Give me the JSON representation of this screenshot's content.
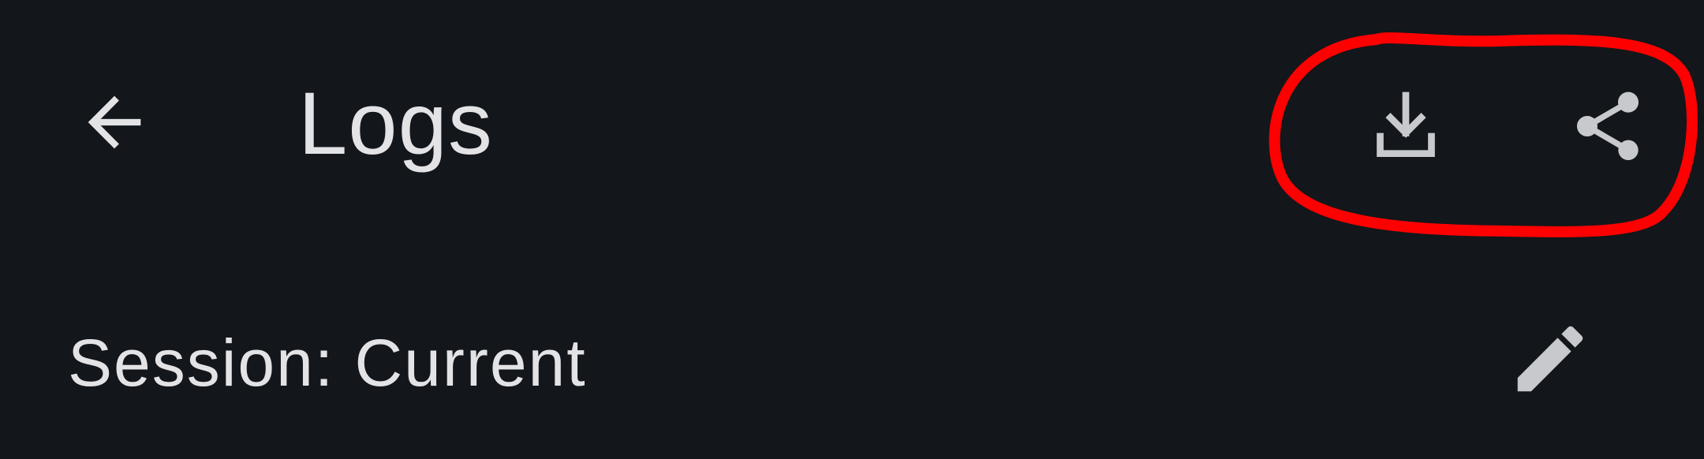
{
  "header": {
    "title": "Logs",
    "back_icon": "arrow-left-icon",
    "actions": [
      {
        "icon": "download-icon"
      },
      {
        "icon": "share-icon"
      }
    ]
  },
  "session": {
    "label": "Session: Current",
    "edit_icon": "pencil-icon"
  },
  "colors": {
    "background": "#13161a",
    "text": "#e3e3e6",
    "icon": "#c8c9cd",
    "annotation": "#ff0000"
  }
}
